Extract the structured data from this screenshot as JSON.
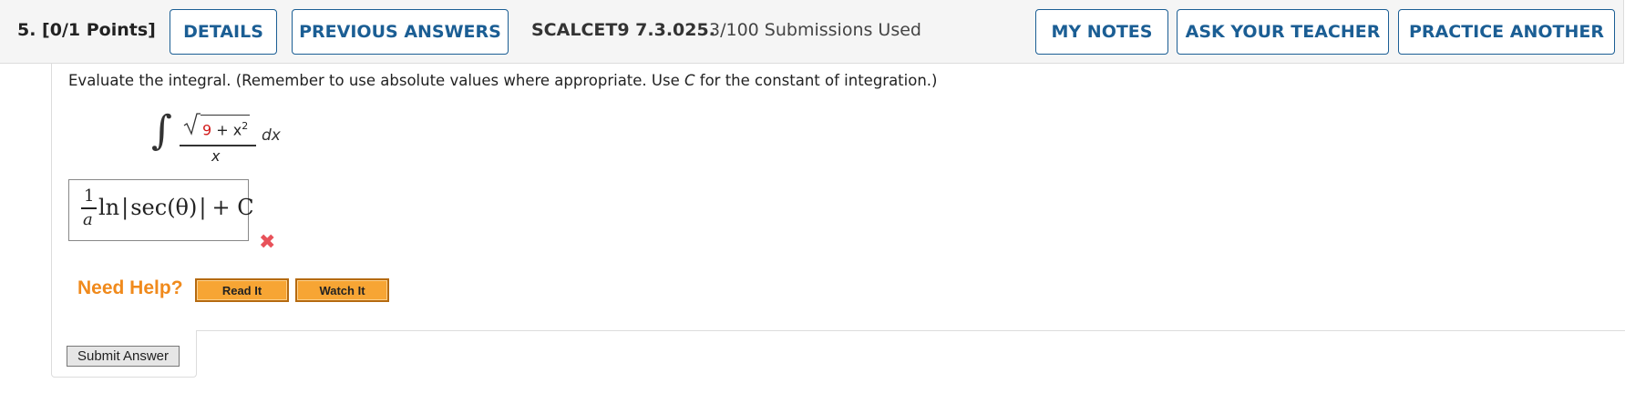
{
  "header": {
    "question_label": "5.  [0/1 Points]",
    "details_label": "DETAILS",
    "previous_answers_label": "PREVIOUS ANSWERS",
    "problem_id": "SCALCET9 7.3.025.",
    "submissions": "3/100 Submissions Used",
    "my_notes_label": "MY NOTES",
    "ask_teacher_label": "ASK YOUR TEACHER",
    "practice_label": "PRACTICE ANOTHER"
  },
  "question": {
    "prompt_before_c": "Evaluate the integral. (Remember to use absolute values where appropriate. Use ",
    "prompt_c": "C",
    "prompt_after_c": " for the constant of integration.)",
    "integrand_num_red": "9",
    "integrand_num_rest": " + x",
    "integrand_exp": "2",
    "integrand_den": "x",
    "dx": "dx"
  },
  "answer": {
    "frac_num": "1",
    "frac_den": "a",
    "ln": "ln",
    "sec_expr": "sec(θ)",
    "plus_c": "+ C",
    "status": "incorrect"
  },
  "help": {
    "title": "Need Help?",
    "read_it": "Read It",
    "watch_it": "Watch It"
  },
  "submit_label": "Submit Answer",
  "colors": {
    "accent_blue": "#1b5e94",
    "help_orange": "#f08a1c",
    "incorrect_red": "#e8525a"
  }
}
